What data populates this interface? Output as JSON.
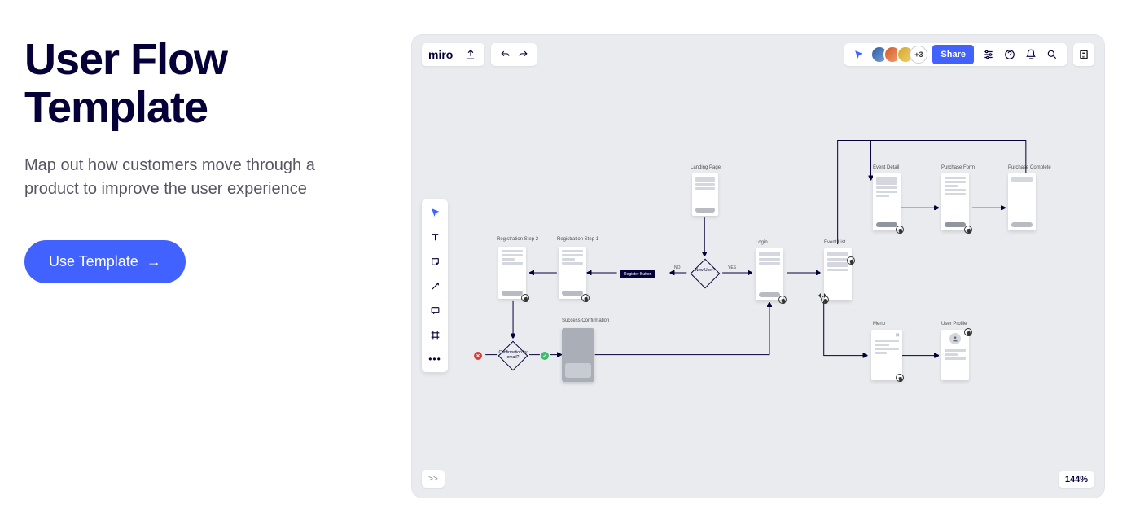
{
  "hero": {
    "title": "User Flow Template",
    "subtitle": "Map out how customers move through a product to improve the user experience",
    "cta_label": "Use Template"
  },
  "board": {
    "logo": "miro",
    "avatar_more": "+3",
    "share_label": "Share",
    "zoom": "144%",
    "toolbar_more": "•••",
    "expand": ">>"
  },
  "flow": {
    "nodes": {
      "landing": "Landing Page",
      "reg1": "Registration Step 1",
      "reg2": "Registration Step 2",
      "register_btn": "Register Button",
      "new_user": "New User?",
      "login": "Login",
      "event_list": "Event List",
      "event_detail": "Event Detail",
      "purchase_form": "Purchase Form",
      "purchase_complete": "Purchase Complete",
      "menu": "Menu",
      "user_profile": "User Profile",
      "success": "Success Confirmation",
      "confirm_email": "Confirmation by email?",
      "yes": "YES",
      "no": "NO"
    }
  }
}
